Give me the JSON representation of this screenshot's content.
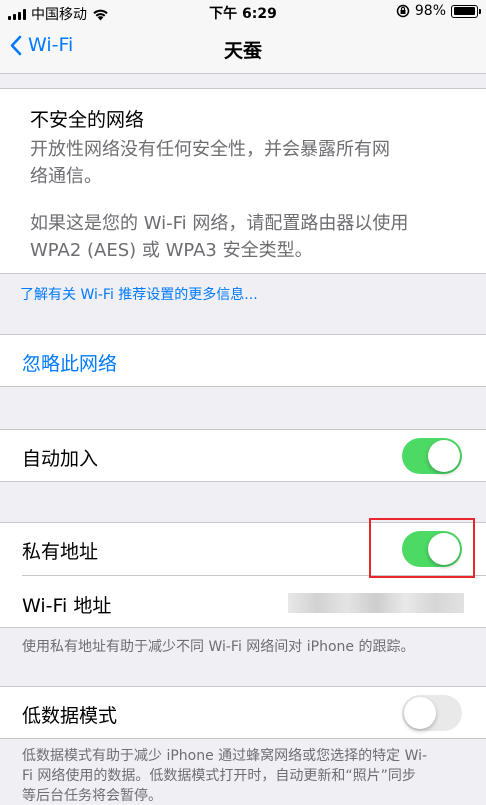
{
  "status_bar": {
    "carrier": "中国移动",
    "time": "下午 6:29",
    "battery": "98%",
    "battery_level": 0.98
  },
  "nav": {
    "back_label": "Wi-Fi",
    "title": "天蚕"
  },
  "warning": {
    "title": "不安全的网络",
    "line1": "开放性网络没有任何安全性，并会暴露所有网",
    "line2": "络通信。",
    "line3": "如果这是您的 Wi-Fi 网络，请配置路由器以使用",
    "line4": "WPA2 (AES) 或 WPA3 安全类型。"
  },
  "learn_more_link": "了解有关 Wi-Fi 推荐设置的更多信息...",
  "forget_network": "忽略此网络",
  "auto_join": {
    "label": "自动加入",
    "on": true
  },
  "private_address": {
    "label": "私有地址",
    "on": true
  },
  "wifi_address": {
    "label": "Wi-Fi 地址"
  },
  "private_footer": "使用私有地址有助于减少不同 Wi-Fi 网络间对 iPhone 的跟踪。",
  "low_data": {
    "label": "低数据模式",
    "on": false
  },
  "low_data_footer_line1": "低数据模式有助于减少 iPhone 通过蜂窝网络或您选择的特定 Wi-",
  "low_data_footer_line2": "Fi 网络使用的数据。低数据模式打开时，自动更新和“照片”同步",
  "low_data_footer_line3": "等后台任务将会暂停。",
  "colors": {
    "accent": "#007aff",
    "toggle_on": "#4cd964",
    "highlight": "#e8262b",
    "background": "#efeff4"
  }
}
